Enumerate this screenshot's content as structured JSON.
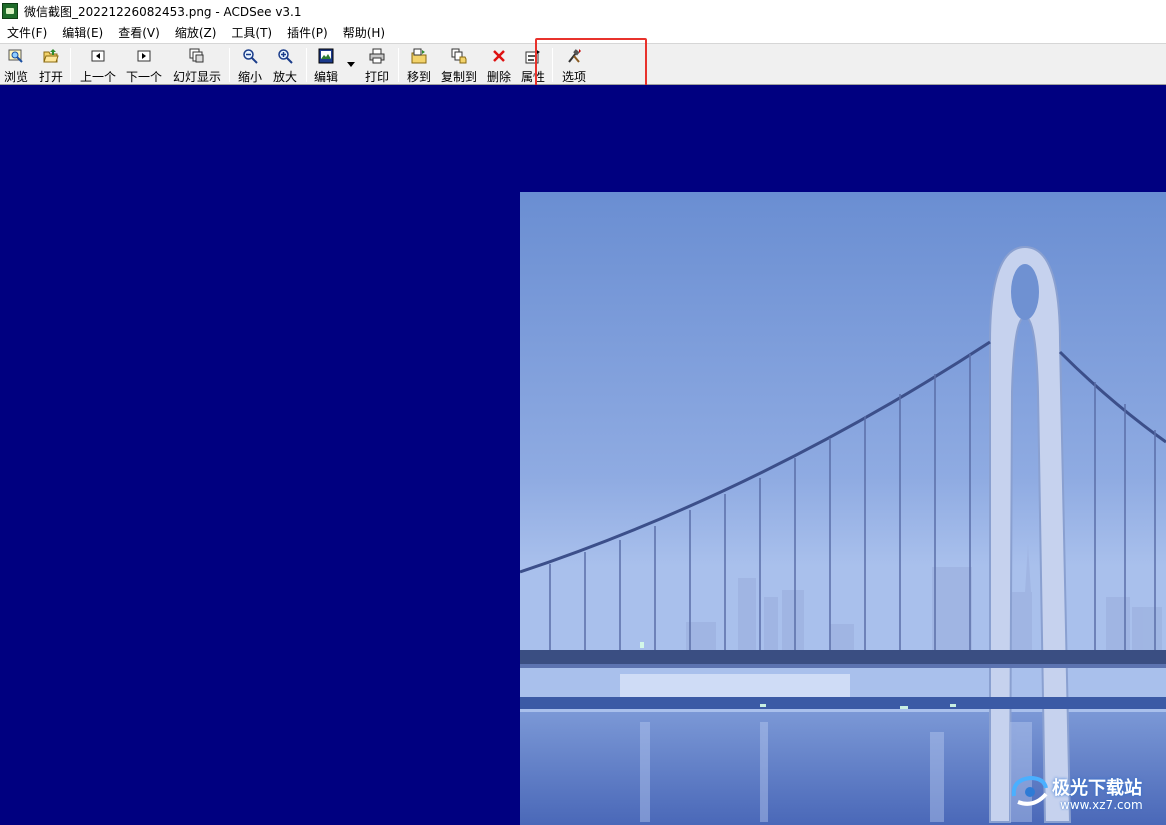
{
  "window": {
    "title": "微信截图_20221226082453.png - ACDSee v3.1"
  },
  "menu": {
    "items": [
      {
        "label": "文件(F)"
      },
      {
        "label": "编辑(E)"
      },
      {
        "label": "查看(V)"
      },
      {
        "label": "缩放(Z)"
      },
      {
        "label": "工具(T)"
      },
      {
        "label": "插件(P)"
      },
      {
        "label": "帮助(H)"
      }
    ]
  },
  "toolbar": {
    "browse": {
      "label": "浏览",
      "icon": "browse-icon"
    },
    "open": {
      "label": "打开",
      "icon": "folder-open-icon"
    },
    "prev": {
      "label": "上一个",
      "icon": "previous-icon"
    },
    "next": {
      "label": "下一个",
      "icon": "next-icon"
    },
    "slideshow": {
      "label": "幻灯显示",
      "icon": "slideshow-icon"
    },
    "zoom_out": {
      "label": "缩小",
      "icon": "zoom-out-icon"
    },
    "zoom_in": {
      "label": "放大",
      "icon": "zoom-in-icon"
    },
    "edit": {
      "label": "编辑",
      "icon": "edit-icon"
    },
    "print": {
      "label": "打印",
      "icon": "printer-icon"
    },
    "move_to": {
      "label": "移到",
      "icon": "move-to-icon"
    },
    "copy_to": {
      "label": "复制到",
      "icon": "copy-to-icon"
    },
    "delete": {
      "label": "删除",
      "icon": "delete-icon"
    },
    "properties": {
      "label": "属性",
      "icon": "properties-icon"
    },
    "options": {
      "label": "选项",
      "icon": "options-icon"
    }
  },
  "colors": {
    "viewer_background": "#000080",
    "highlight": "#e8322c",
    "toolbar": "#f0f0f0"
  },
  "watermark": {
    "name": "极光下载站",
    "url": "www.xz7.com"
  }
}
